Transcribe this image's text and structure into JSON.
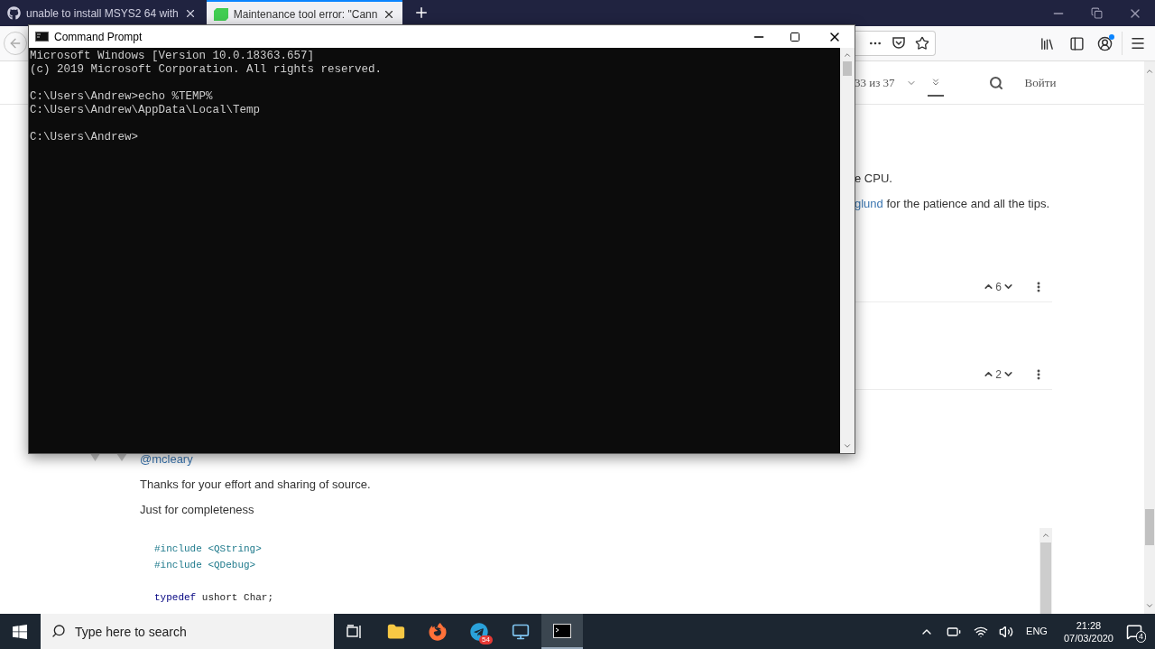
{
  "browser_tabs": [
    {
      "title": "unable to install MSYS2 64 with",
      "selected": false,
      "kind": "github"
    },
    {
      "title": "Maintenance tool error: \"Cann",
      "selected": true,
      "kind": "qt"
    }
  ],
  "page_header": {
    "page_counter": "33 из 37",
    "login": "Войти"
  },
  "answer_text": {
    "line_1": "e CPU.",
    "mention": "glund",
    "line_2_rest": " for the patience and all the tips."
  },
  "votes": [
    {
      "count": "6"
    },
    {
      "count": "2"
    }
  ],
  "reply": {
    "mention": "@mcleary",
    "paragraphs": [
      "Thanks for your effort and sharing of source.",
      "Just for completeness"
    ],
    "code_blocks": [
      [
        [
          {
            "text": "#include <QString>",
            "kind": "preprocessor"
          }
        ],
        [
          {
            "text": "#include <QDebug>",
            "kind": "preprocessor"
          }
        ]
      ],
      [
        [
          {
            "text": "typedef",
            "kind": "keyword"
          },
          {
            "text": " ushort Char;",
            "kind": "plain"
          }
        ]
      ]
    ]
  },
  "cmd": {
    "title": "Command Prompt",
    "output_blocks": [
      [
        "Microsoft Windows [Version 10.0.18363.657]",
        "(c) 2019 Microsoft Corporation. All rights reserved."
      ],
      [
        "C:\\Users\\Andrew>echo %TEMP%",
        "C:\\Users\\Andrew\\AppData\\Local\\Temp"
      ],
      [
        "C:\\Users\\Andrew>"
      ]
    ]
  },
  "taskbar": {
    "search_placeholder": "Type here to search",
    "apps": [
      {
        "kind": "task-view",
        "selected": false
      },
      {
        "kind": "explorer",
        "selected": false
      },
      {
        "kind": "firefox",
        "selected": false
      },
      {
        "kind": "telegram",
        "selected": false,
        "badge": "54"
      },
      {
        "kind": "monitor",
        "selected": false
      },
      {
        "kind": "terminal",
        "selected": true
      }
    ],
    "language": "ENG",
    "time": "21:28",
    "date": "07/03/2020",
    "notification_count": "4"
  }
}
